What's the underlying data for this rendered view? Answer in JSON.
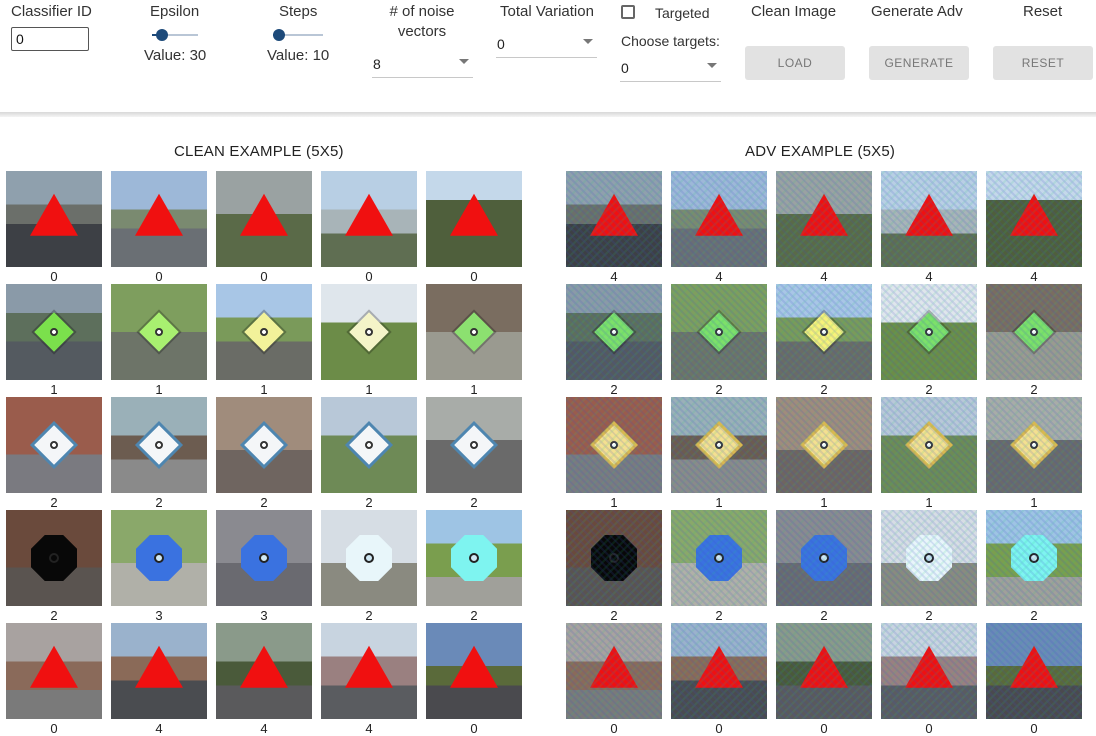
{
  "controls": {
    "classifier_id": {
      "label": "Classifier ID",
      "value": "0"
    },
    "epsilon": {
      "label": "Epsilon",
      "value_text": "Value: 30",
      "level": 0.3
    },
    "steps": {
      "label": "Steps",
      "value_text": "Value: 10",
      "level": 0.1
    },
    "noise_vectors": {
      "label_line1": "# of noise",
      "label_line2": "vectors",
      "value": "8"
    },
    "total_variation": {
      "label": "Total Variation",
      "value": "0"
    },
    "targeted": {
      "label": "Targeted",
      "checked": false
    },
    "choose_targets": {
      "label": "Choose targets:",
      "value": "0"
    },
    "clean_image": {
      "label": "Clean Image",
      "button": "LOAD"
    },
    "generate_adv": {
      "label": "Generate Adv",
      "button": "GENERATE"
    },
    "reset": {
      "label": "Reset",
      "button": "RESET"
    }
  },
  "clean": {
    "title": "CLEAN EXAMPLE (5X5)",
    "labels": [
      [
        "0",
        "0",
        "0",
        "0",
        "0"
      ],
      [
        "1",
        "1",
        "1",
        "1",
        "1"
      ],
      [
        "2",
        "2",
        "2",
        "2",
        "2"
      ],
      [
        "2",
        "3",
        "3",
        "2",
        "2"
      ],
      [
        "0",
        "4",
        "4",
        "4",
        "0"
      ]
    ]
  },
  "adv": {
    "title": "ADV EXAMPLE (5X5)",
    "labels": [
      [
        "4",
        "4",
        "4",
        "4",
        "4"
      ],
      [
        "2",
        "2",
        "2",
        "2",
        "2"
      ],
      [
        "1",
        "1",
        "1",
        "1",
        "1"
      ],
      [
        "2",
        "2",
        "2",
        "2",
        "2"
      ],
      [
        "0",
        "0",
        "0",
        "0",
        "0"
      ]
    ]
  },
  "colors": {
    "slider_active": "#1d4a7a",
    "button_bg": "#e2e2e2",
    "sign_red": "#f01010"
  }
}
